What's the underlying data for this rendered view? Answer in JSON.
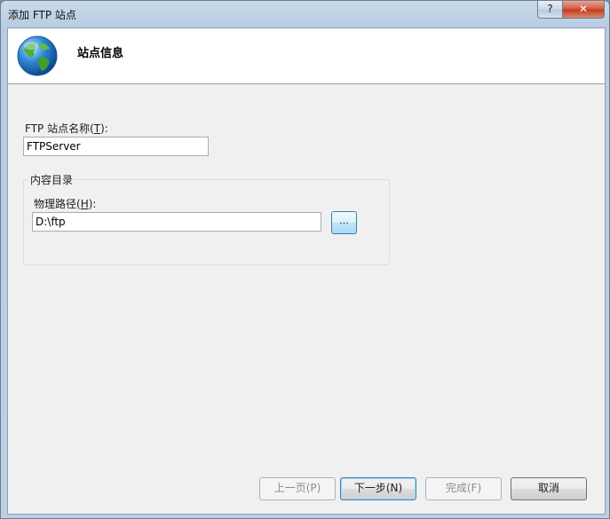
{
  "window": {
    "title": "添加 FTP 站点",
    "help_label": "?",
    "close_label": "✕"
  },
  "header": {
    "title": "站点信息",
    "icon": "globe-icon"
  },
  "site_name": {
    "label": "FTP 站点名称(",
    "accesskey": "T",
    "label_suffix": "):",
    "value": "FTPServer"
  },
  "content_dir": {
    "group_title": "内容目录",
    "path_label": "物理路径(",
    "path_accesskey": "H",
    "path_label_suffix": "):",
    "path_value": "D:\\ftp",
    "browse_label": "..."
  },
  "footer": {
    "prev_label": "上一页(P)",
    "next_label": "下一步(N)",
    "finish_label": "完成(F)",
    "cancel_label": "取消"
  },
  "colors": {
    "client_bg": "#f0f0f0",
    "header_bg": "#ffffff",
    "close_btn": "#c2391b",
    "focus_border": "#3c7fb1"
  }
}
